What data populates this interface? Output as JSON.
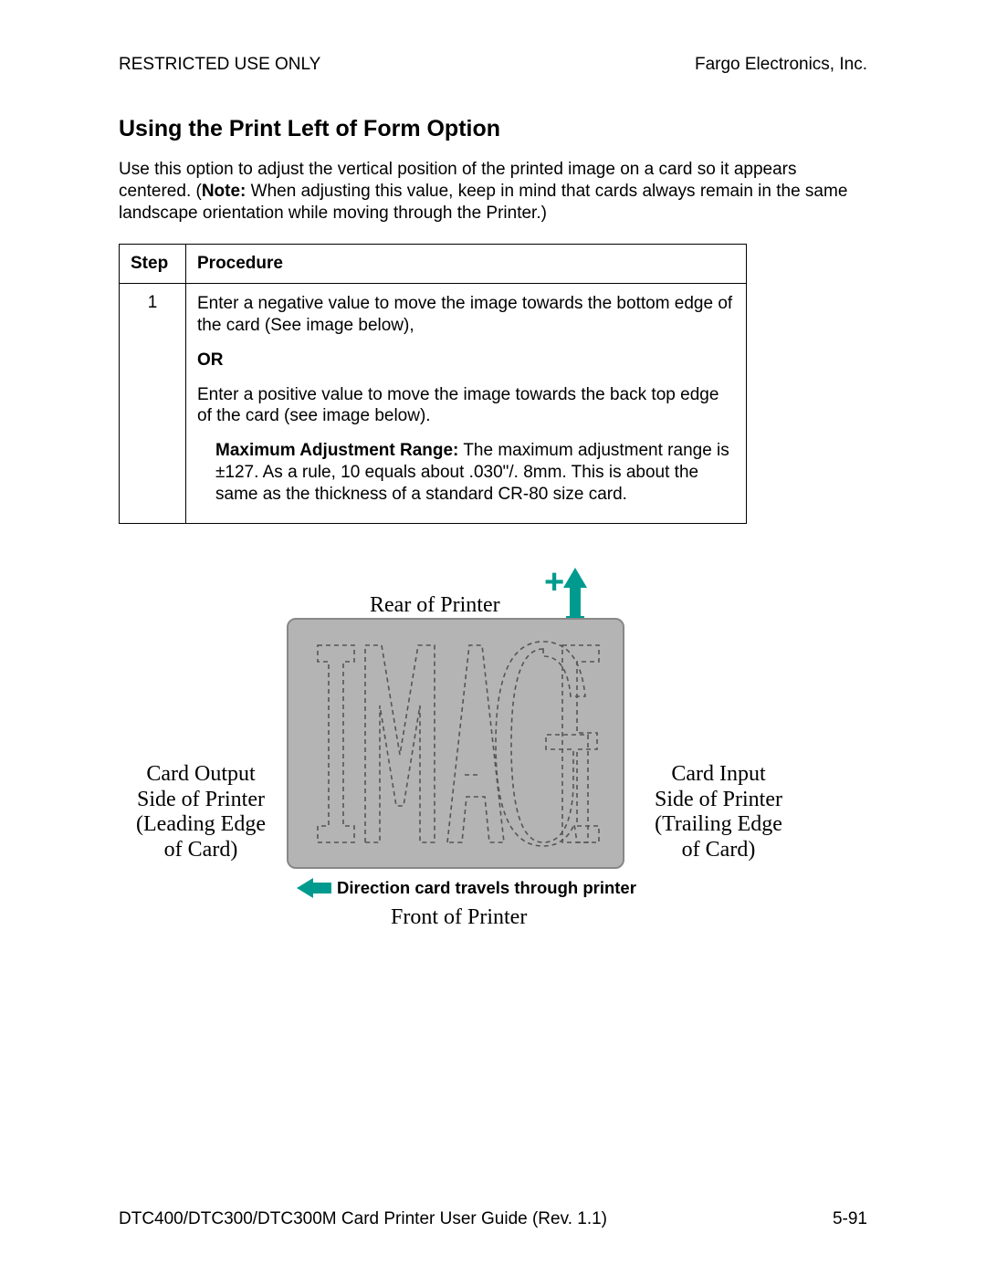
{
  "header": {
    "left": "RESTRICTED USE ONLY",
    "right": "Fargo Electronics, Inc."
  },
  "section": {
    "heading": "Using the Print Left of Form Option",
    "intro_pre": "Use this option to adjust the vertical position of the printed image on a card so it appears centered. (",
    "intro_note_label": "Note:",
    "intro_post": "  When adjusting this value, keep in mind that cards always remain in the same landscape orientation while moving through the Printer.)"
  },
  "table": {
    "headers": {
      "step": "Step",
      "procedure": "Procedure"
    },
    "rows": [
      {
        "step": "1",
        "para1": "Enter a negative value to move the image towards the bottom edge of the card (See image below),",
        "or": "OR",
        "para2": "Enter a positive value to move the image towards the back top edge of the card (see image below).",
        "range_label": "Maximum Adjustment Range:",
        "range_text": "  The maximum adjustment range is ±127. As a rule, 10 equals about .030\"/. 8mm. This is about the same as the thickness of a standard CR-80 size card."
      }
    ]
  },
  "diagram": {
    "plus": "+",
    "rear": "Rear of Printer",
    "front": "Front of Printer",
    "left_lines": [
      "Card Output",
      "Side of Printer",
      "(Leading Edge",
      "of Card)"
    ],
    "right_lines": [
      "Card Input",
      "Side of Printer",
      "(Trailing Edge",
      "of Card)"
    ],
    "direction": "Direction card travels through printer",
    "image_word": "IMAGE"
  },
  "footer": {
    "left": "DTC400/DTC300/DTC300M Card Printer User Guide (Rev. 1.1)",
    "right": "5-91"
  }
}
